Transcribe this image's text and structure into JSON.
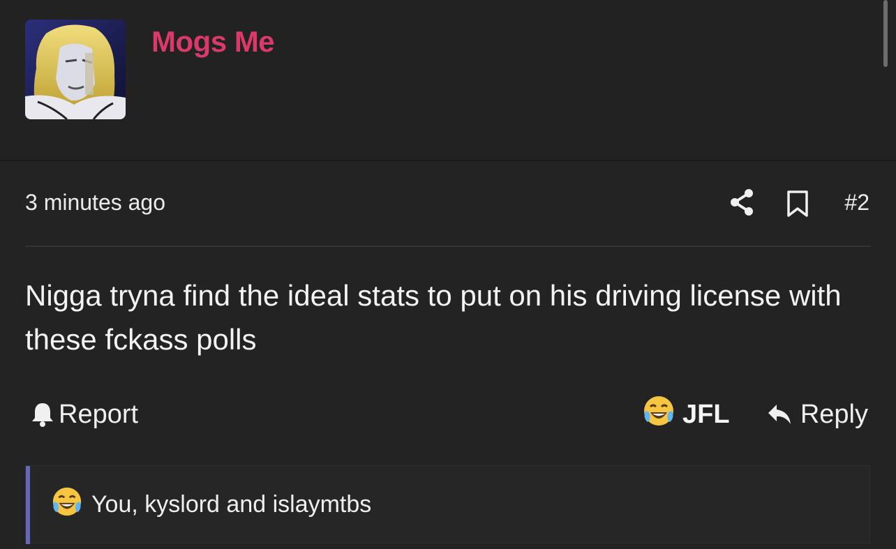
{
  "post": {
    "username": "Mogs Me",
    "username_color": "#d93a6a",
    "timestamp": "3 minutes ago",
    "post_number": "#2",
    "message": "Nigga tryna find the ideal stats to put on his driving license with these fckass polls"
  },
  "icons": {
    "share": "share-icon",
    "bookmark": "bookmark-icon",
    "report": "bell-icon",
    "reply": "reply-arrow-icon",
    "reaction": "laughing-crying-emoji"
  },
  "actions": {
    "report_label": "Report",
    "reaction_label": "JFL",
    "reply_label": "Reply"
  },
  "reactions": {
    "summary": "You, kyslord and islaymtbs",
    "accent_color": "#6468b8"
  }
}
